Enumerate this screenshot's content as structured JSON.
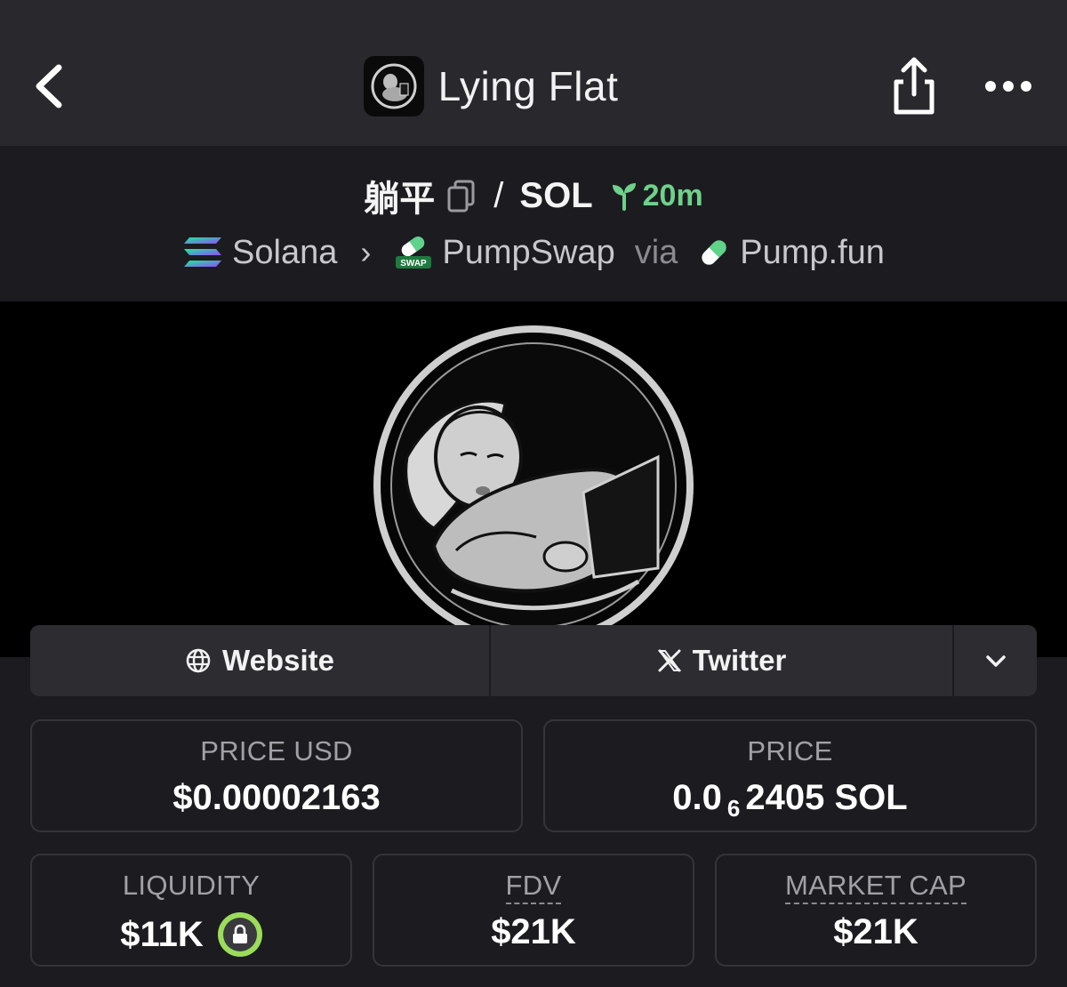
{
  "header": {
    "title": "Lying Flat"
  },
  "pair": {
    "base": "躺平",
    "separator": "/",
    "quote": "SOL",
    "age": "20m"
  },
  "route": {
    "chain": "Solana",
    "dex": "PumpSwap",
    "via_label": "via",
    "launchpad": "Pump.fun",
    "swap_badge": "SWAP"
  },
  "links": {
    "website": "Website",
    "twitter": "Twitter"
  },
  "stats": {
    "price_usd": {
      "label": "PRICE USD",
      "value": "$0.00002163"
    },
    "price": {
      "label": "PRICE",
      "prefix": "0.0",
      "subscript": "6",
      "suffix": "2405 SOL"
    },
    "liquidity": {
      "label": "LIQUIDITY",
      "value": "$11K"
    },
    "fdv": {
      "label": "FDV",
      "value": "$21K"
    },
    "market_cap": {
      "label": "MARKET CAP",
      "value": "$21K"
    }
  },
  "colors": {
    "accent_green": "#6fd18a",
    "lock_green": "#9bdc5b",
    "background": "#1c1c20",
    "topbar": "#28282d"
  },
  "icons": [
    "back-arrow-icon",
    "share-icon",
    "more-icon",
    "copy-icon",
    "sprout-icon",
    "solana-icon",
    "chevron-right-icon",
    "pumpswap-icon",
    "pill-icon",
    "globe-icon",
    "x-icon",
    "chevron-down-icon",
    "lock-icon"
  ]
}
